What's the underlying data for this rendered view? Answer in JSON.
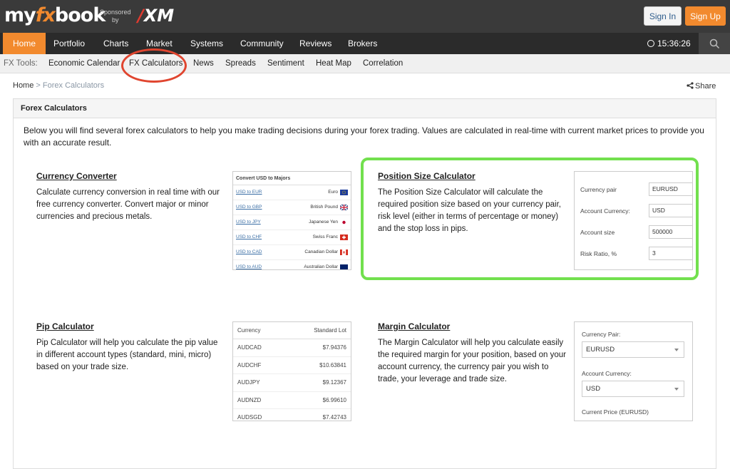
{
  "header": {
    "logo_my": "my",
    "logo_fx": "fx",
    "logo_book": "book",
    "sponsored": "Sponsored",
    "by": "by",
    "sponsor_brand_slash": "/",
    "sponsor_brand": "XM",
    "signin_label": "Sign In",
    "signup_label": "Sign Up"
  },
  "mainnav": {
    "items": [
      "Home",
      "Portfolio",
      "Charts",
      "Market",
      "Systems",
      "Community",
      "Reviews",
      "Brokers"
    ],
    "active": "Home",
    "clock": "15:36:26"
  },
  "subnav": {
    "label": "FX Tools:",
    "items": [
      "Economic Calendar",
      "FX Calculators",
      "News",
      "Spreads",
      "Sentiment",
      "Heat Map",
      "Correlation"
    ]
  },
  "breadcrumb": {
    "home": "Home",
    "separator": " > ",
    "current": "Forex Calculators"
  },
  "share_label": "Share",
  "panel": {
    "title": "Forex Calculators",
    "intro": "Below you will find several forex calculators to help you make trading decisions during your forex trading. Values are calculated in real-time with current market prices to provide you with an accurate result."
  },
  "calculators": {
    "currency_converter": {
      "title": "Currency Converter",
      "desc": "Calculate currency conversion in real time with our free currency converter. Convert major or minor currencies and precious metals.",
      "thumb_title": "Convert USD to Majors",
      "rows": [
        {
          "link": "USD to EUR",
          "name": "Euro"
        },
        {
          "link": "USD to GBP",
          "name": "British Pound"
        },
        {
          "link": "USD to JPY",
          "name": "Japanese Yen"
        },
        {
          "link": "USD to CHF",
          "name": "Swiss Franc"
        },
        {
          "link": "USD to CAD",
          "name": "Canadian Dollar"
        },
        {
          "link": "USD to AUD",
          "name": "Australian Dollar"
        }
      ]
    },
    "position_size": {
      "title": "Position Size Calculator",
      "desc": "The Position Size Calculator will calculate the required position size based on your currency pair, risk level (either in terms of percentage or money) and the stop loss in pips.",
      "fields": [
        {
          "label": "Currency pair",
          "value": "EURUSD"
        },
        {
          "label": "Account Currency:",
          "value": "USD"
        },
        {
          "label": "Account size",
          "value": "500000"
        },
        {
          "label": "Risk Ratio, %",
          "value": "3"
        }
      ]
    },
    "pip": {
      "title": "Pip Calculator",
      "desc": "Pip Calculator will help you calculate the pip value in different account types (standard, mini, micro) based on your trade size.",
      "col_currency": "Currency",
      "col_lot": "Standard Lot",
      "rows": [
        {
          "pair": "AUDCAD",
          "value": "$7.94376"
        },
        {
          "pair": "AUDCHF",
          "value": "$10.63841"
        },
        {
          "pair": "AUDJPY",
          "value": "$9.12367"
        },
        {
          "pair": "AUDNZD",
          "value": "$6.99610"
        },
        {
          "pair": "AUDSGD",
          "value": "$7.42743"
        }
      ]
    },
    "margin": {
      "title": "Margin Calculator",
      "desc": "The Margin Calculator will help you calculate easily the required margin for your position, based on your account currency, the currency pair you wish to trade, your leverage and trade size.",
      "pair_label": "Currency Pair:",
      "pair_value": "EURUSD",
      "acct_label": "Account Currency:",
      "acct_value": "USD",
      "price_label": "Current Price (EURUSD)"
    }
  },
  "colors": {
    "brand_orange": "#f28a2e",
    "header_dark": "#3a3a3a",
    "nav_dark": "#2b2b2b",
    "highlight_green": "#72e04e",
    "highlight_red": "#e0452f"
  }
}
